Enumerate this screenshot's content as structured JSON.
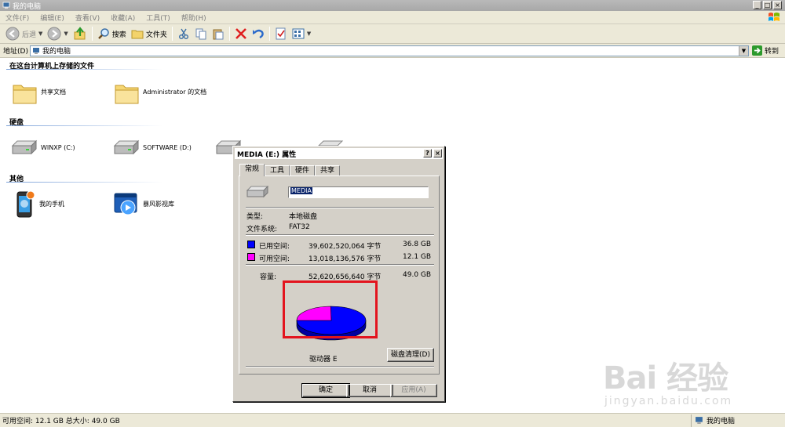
{
  "window": {
    "title": "我的电脑",
    "buttons": {
      "minimize": "_",
      "maximize": "□",
      "close": "×"
    }
  },
  "menu": [
    "文件(F)",
    "编辑(E)",
    "查看(V)",
    "收藏(A)",
    "工具(T)",
    "帮助(H)"
  ],
  "toolbar": {
    "back": "后退",
    "search": "搜索",
    "folders": "文件夹"
  },
  "address": {
    "label": "地址(D)",
    "value": "我的电脑",
    "go": "转到"
  },
  "groups": {
    "stored": {
      "title": "在这台计算机上存储的文件",
      "items": [
        {
          "label": "共享文档",
          "icon": "folder-icon"
        },
        {
          "label": "Administrator 的文档",
          "icon": "folder-icon"
        }
      ]
    },
    "hdd": {
      "title": "硬盘",
      "items": [
        {
          "label": "WINXP (C:)",
          "icon": "drive-icon"
        },
        {
          "label": "SOFTWARE (D:)",
          "icon": "drive-icon"
        }
      ]
    },
    "other": {
      "title": "其他",
      "items": [
        {
          "label": "我的手机",
          "icon": "phone-icon"
        },
        {
          "label": "暴风影视库",
          "icon": "media-library-icon"
        }
      ]
    }
  },
  "dialog": {
    "title": "MEDIA (E:) 属性",
    "help": "?",
    "close": "×",
    "tabs": [
      "常规",
      "工具",
      "硬件",
      "共享"
    ],
    "name_value": "MEDIA",
    "type_label": "类型:",
    "type_value": "本地磁盘",
    "fs_label": "文件系统:",
    "fs_value": "FAT32",
    "used_label": "已用空间:",
    "used_bytes": "39,602,520,064 字节",
    "used_gb": "36.8 GB",
    "free_label": "可用空间:",
    "free_bytes": "13,018,136,576 字节",
    "free_gb": "12.1 GB",
    "capacity_label": "容量:",
    "capacity_bytes": "52,620,656,640 字节",
    "capacity_gb": "49.0 GB",
    "drive_label": "驱动器 E",
    "cleanup": "磁盘清理(D)",
    "ok": "确定",
    "cancel": "取消",
    "apply": "应用(A)",
    "colors": {
      "used": "#0000ff",
      "free": "#ff00ff"
    },
    "used_fraction": 0.7526
  },
  "status": {
    "left": "可用空间: 12.1 GB 总大小: 49.0 GB",
    "right": "我的电脑"
  },
  "watermark": {
    "big": "Bai 经验",
    "small": "jingyan.baidu.com"
  }
}
